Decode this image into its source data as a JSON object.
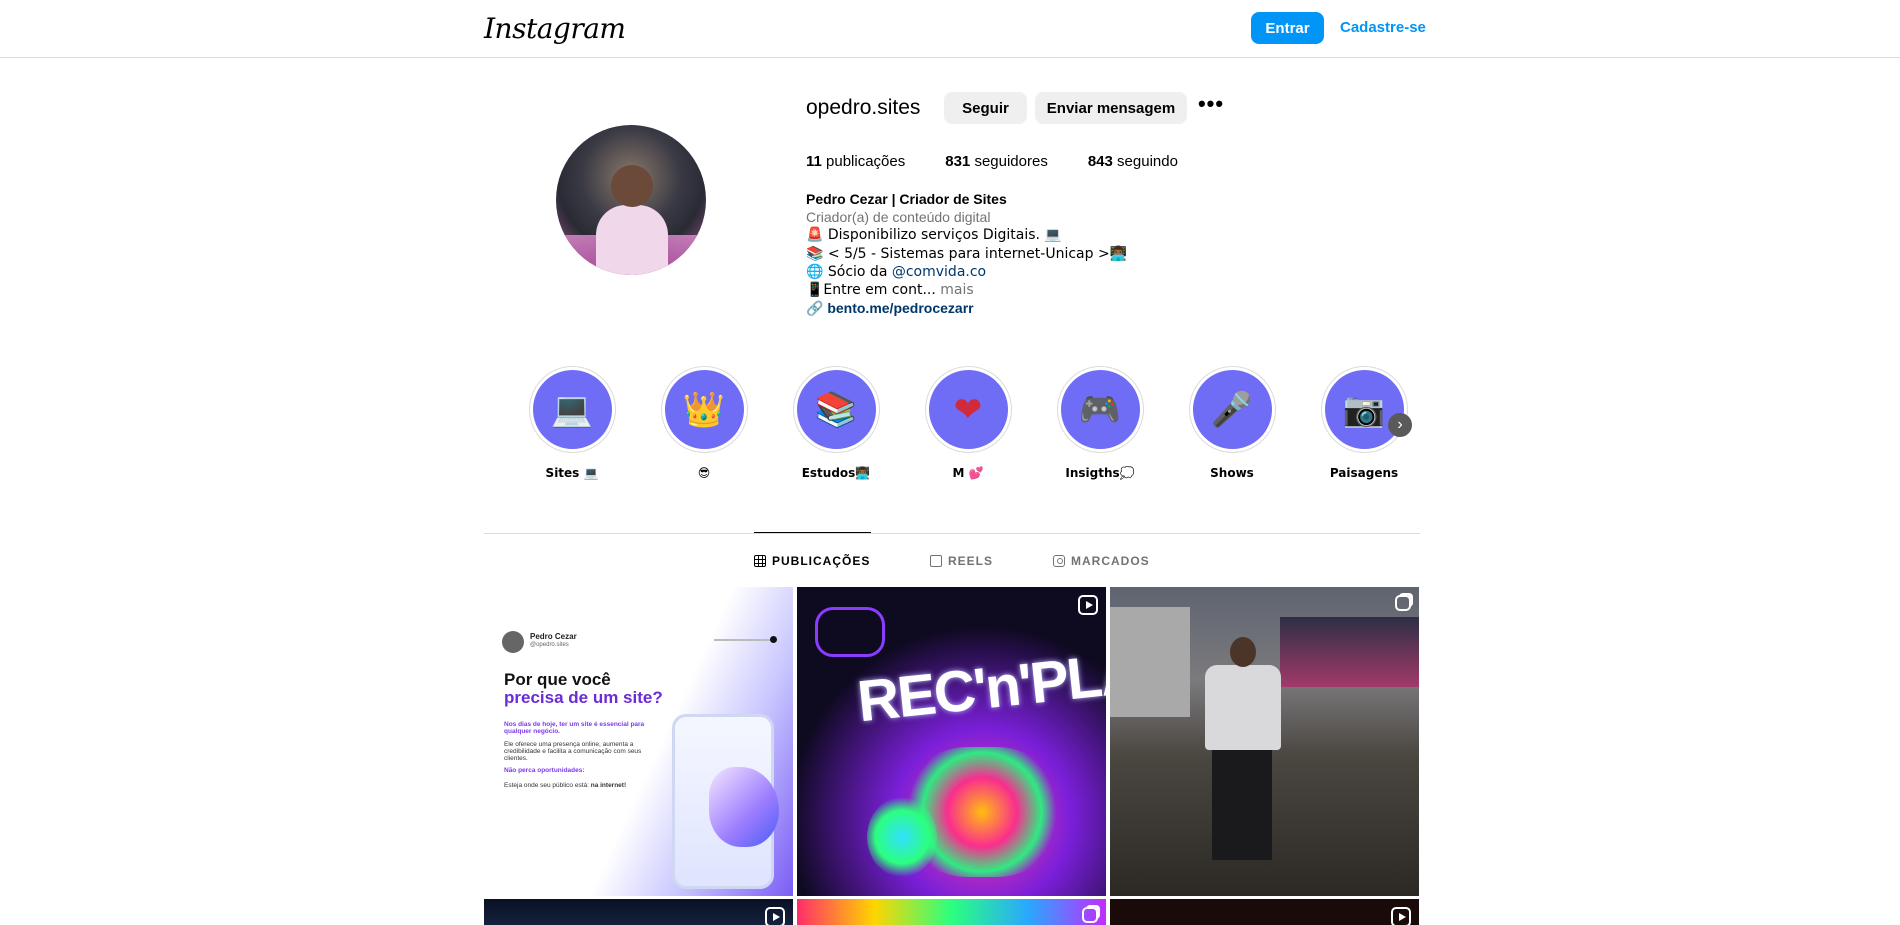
{
  "topbar": {
    "logo": "Instagram",
    "login_label": "Entrar",
    "signup_label": "Cadastre-se"
  },
  "profile": {
    "username": "opedro.sites",
    "follow_label": "Seguir",
    "message_label": "Enviar mensagem",
    "more_label": "•••",
    "stats": {
      "posts_count": "11",
      "posts_label": " publicações",
      "followers_count": "831",
      "followers_label": " seguidores",
      "following_count": "843",
      "following_label": " seguindo"
    },
    "bio": {
      "name": "Pedro Cezar | Criador de Sites",
      "category": "Criador(a) de conteúdo digital",
      "line1": "🚨 Disponibilizo serviços Digitais. 💻",
      "line2": "📚 < 5/5 - Sistemas para internet-Unicap >👨🏾‍💻",
      "line3_prefix": "🌐 Sócio da ",
      "line3_mention": "@comvida.co",
      "line4": "📱Entre em cont...",
      "more": " mais",
      "link_icon": "🔗",
      "link": "bento.me/pedrocezarr"
    }
  },
  "highlights": [
    {
      "label": "Sites 💻",
      "icon": "💻"
    },
    {
      "label": "😎",
      "icon": "👑"
    },
    {
      "label": "Estudos👨🏾‍💻",
      "icon": "📚"
    },
    {
      "label": "M 💕",
      "icon": "❤"
    },
    {
      "label": "Insigths💭",
      "icon": "🎮"
    },
    {
      "label": "Shows",
      "icon": "🎤"
    },
    {
      "label": "Paisagens",
      "icon": "📷"
    }
  ],
  "tabs": {
    "posts": "PUBLICAÇÕES",
    "reels": "REELS",
    "tagged": "MARCADOS"
  },
  "posts": {
    "p1": {
      "author": "Pedro Cezar",
      "handle": "@opedro.sites",
      "title1": "Por que você",
      "title2": "precisa de um site?",
      "para1": "Nos dias de hoje, ter um site é essencial para qualquer negócio.",
      "para2": "Ele oferece uma presença online, aumenta a credibilidade e facilita a comunicação com seus clientes.",
      "para3": "Não perca oportunidades:",
      "para4_prefix": "Esteja onde seu público está: ",
      "para4_bold": "na internet!"
    },
    "p2": {
      "text": "REC'n'PLAY"
    }
  },
  "colors": {
    "accent": "#0095f6",
    "highlight_bg": "#6f6cf5",
    "link": "#00376b"
  }
}
